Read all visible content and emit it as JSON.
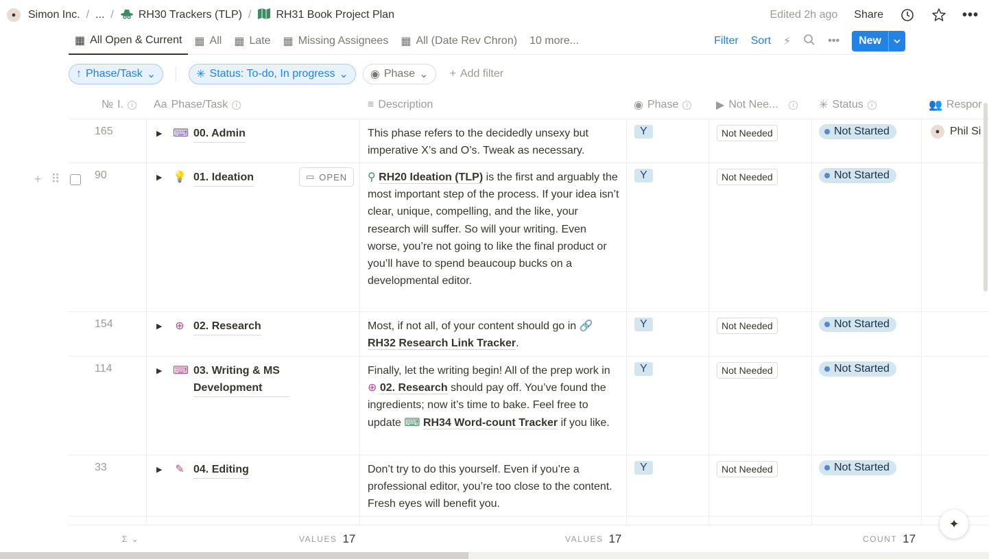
{
  "breadcrumb": {
    "workspace": "Simon Inc.",
    "ellipsis": "...",
    "parent": "RH30 Trackers (TLP)",
    "current": "RH31 Book Project Plan"
  },
  "header": {
    "edited": "Edited 2h ago",
    "share": "Share"
  },
  "views": {
    "tabs": [
      "All Open & Current",
      "All",
      "Late",
      "Missing Assignees",
      "All (Date Rev Chron)"
    ],
    "more": "10 more...",
    "filter": "Filter",
    "sort": "Sort",
    "new": "New"
  },
  "filters": {
    "sort_pill": "Phase/Task",
    "status_pill": "Status: To-do, In progress",
    "phase_pill": "Phase",
    "add_filter": "Add filter"
  },
  "columns": {
    "num": "I.",
    "task": "Phase/Task",
    "description": "Description",
    "phase": "Phase",
    "not_needed": "Not Nee...",
    "status": "Status",
    "responsible": "Respor"
  },
  "rows": [
    {
      "num": "165",
      "task": "00. Admin",
      "desc": "This phase refers to the decidedly unsexy but imperative X’s and O’s. Tweak as necessary.",
      "phase": "Y",
      "not_needed": "Not Needed",
      "status": "Not Started",
      "responsible": "Phil Si"
    },
    {
      "num": "90",
      "task": "01. Ideation",
      "open": "OPEN",
      "desc_link": "RH20 Ideation (TLP)",
      "desc": " is the first and arguably the most important step of the process. If your idea isn’t clear, unique, compelling, and the like, your research will suffer. So will your writing. Even worse, you’re not going to like the final product or you’ll have to spend beaucoup bucks on a developmental editor.",
      "phase": "Y",
      "not_needed": "Not Needed",
      "status": "Not Started"
    },
    {
      "num": "154",
      "task": "02. Research",
      "desc": "Most, if not all, of your content should go in ",
      "desc_link": "RH32 Research Link Tracker",
      "desc_end": ".",
      "phase": "Y",
      "not_needed": "Not Needed",
      "status": "Not Started"
    },
    {
      "num": "114",
      "task": "03. Writing & MS Development",
      "desc": "Finally, let the writing begin! All of the prep work in ",
      "desc_link": "02. Research",
      "desc_mid": " should pay off. You’ve found the ingredients; now it’s time to bake. Feel free to update ",
      "desc_link2": "RH34 Word-count Tracker",
      "desc_end": " if you like.",
      "phase": "Y",
      "not_needed": "Not Needed",
      "status": "Not Started"
    },
    {
      "num": "33",
      "task": "04. Editing",
      "desc": "Don’t try to do this yourself. Even if you’re a professional editor, you’re too close to the content. Fresh eyes will benefit you.",
      "phase": "Y",
      "not_needed": "Not Needed",
      "status": "Not Started"
    }
  ],
  "footer": {
    "values_label": "VALUES",
    "values_count": "17",
    "values2_label": "VALUES",
    "values2_count": "17",
    "count_label": "COUNT",
    "count_count": "17"
  },
  "icons": {
    "workspace": "avatar-icon",
    "parent": "spy-hat-icon",
    "current": "book-map-icon",
    "history": "clock-icon",
    "favorite": "star-icon",
    "more": "ellipsis-icon"
  }
}
